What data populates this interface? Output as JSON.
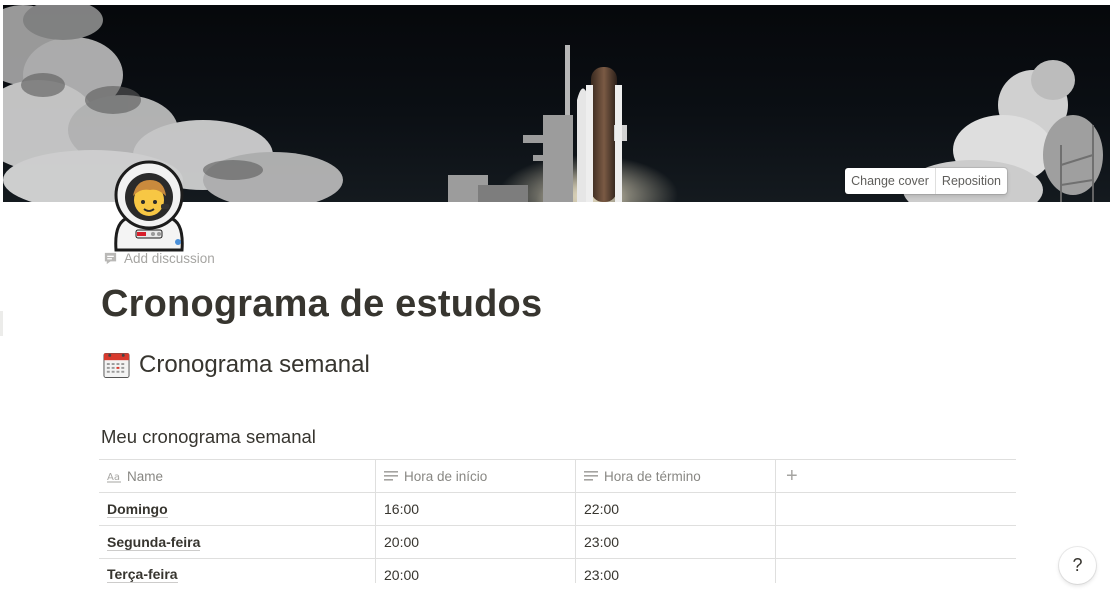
{
  "cover": {
    "change_label": "Change cover",
    "reposition_label": "Reposition"
  },
  "page": {
    "icon": "astronaut-emoji-icon",
    "add_discussion": "Add discussion",
    "title": "Cronograma de estudos"
  },
  "section": {
    "icon": "calendar-emoji-icon",
    "heading": "Cronograma semanal"
  },
  "database": {
    "title": "Meu cronograma semanal",
    "columns": [
      {
        "label": "Name",
        "icon": "title-aa-icon"
      },
      {
        "label": "Hora de início",
        "icon": "text-lines-icon"
      },
      {
        "label": "Hora de término",
        "icon": "text-lines-icon"
      }
    ],
    "add_column_label": "+",
    "rows": [
      {
        "name": "Domingo",
        "start": "16:00",
        "end": "22:00"
      },
      {
        "name": "Segunda-feira",
        "start": "20:00",
        "end": "23:00"
      },
      {
        "name": "Terça-feira",
        "start": "20:00",
        "end": "23:00"
      }
    ]
  },
  "help": {
    "label": "?"
  }
}
